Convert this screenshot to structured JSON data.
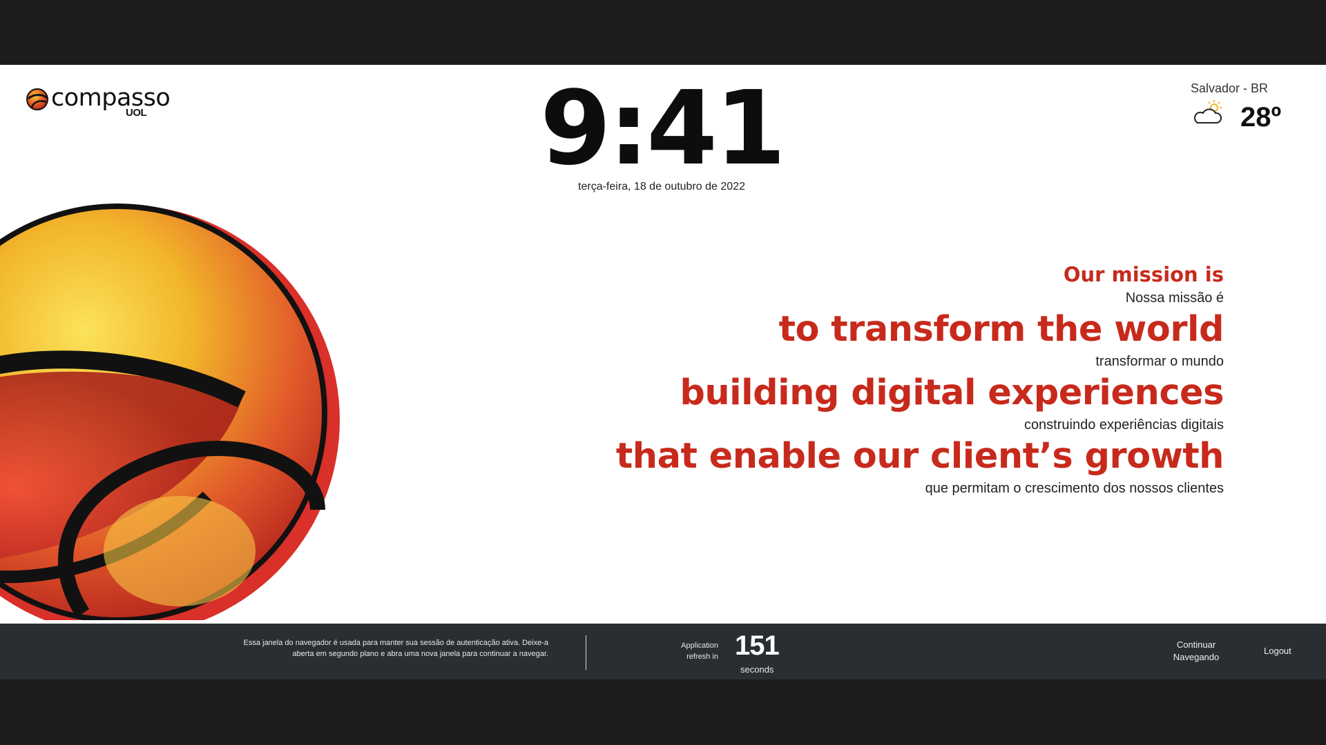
{
  "brand": {
    "name": "compasso",
    "sub": "UOL",
    "colors": {
      "red": "#c72a1c",
      "yellow": "#f2b52a",
      "dark_bar": "#2a2d31"
    }
  },
  "clock": {
    "time": "9:41",
    "date": "terça-feira, 18 de outubro de 2022"
  },
  "weather": {
    "location": "Salvador - BR",
    "temperature": "28º",
    "icon": "partly-cloudy-icon"
  },
  "mission": {
    "title_en": "Our mission is",
    "title_pt": "Nossa missão é",
    "lines": [
      {
        "en": "to transform the world",
        "pt": "transformar o mundo"
      },
      {
        "en": "building digital experiences",
        "pt": "construindo experiências digitais"
      },
      {
        "en": "that enable our client’s growth",
        "pt": "que permitam o crescimento dos nossos clientes"
      }
    ]
  },
  "footer": {
    "notice": "Essa janela do navegador é usada para manter sua sessão de autenticação ativa. Deixe-a aberta em segundo plano e abra uma nova janela para continuar a navegar.",
    "refresh_label": "Application refresh in",
    "refresh_count": "151",
    "refresh_unit": "seconds",
    "continue_label": "Continuar Navegando",
    "logout_label": "Logout"
  }
}
